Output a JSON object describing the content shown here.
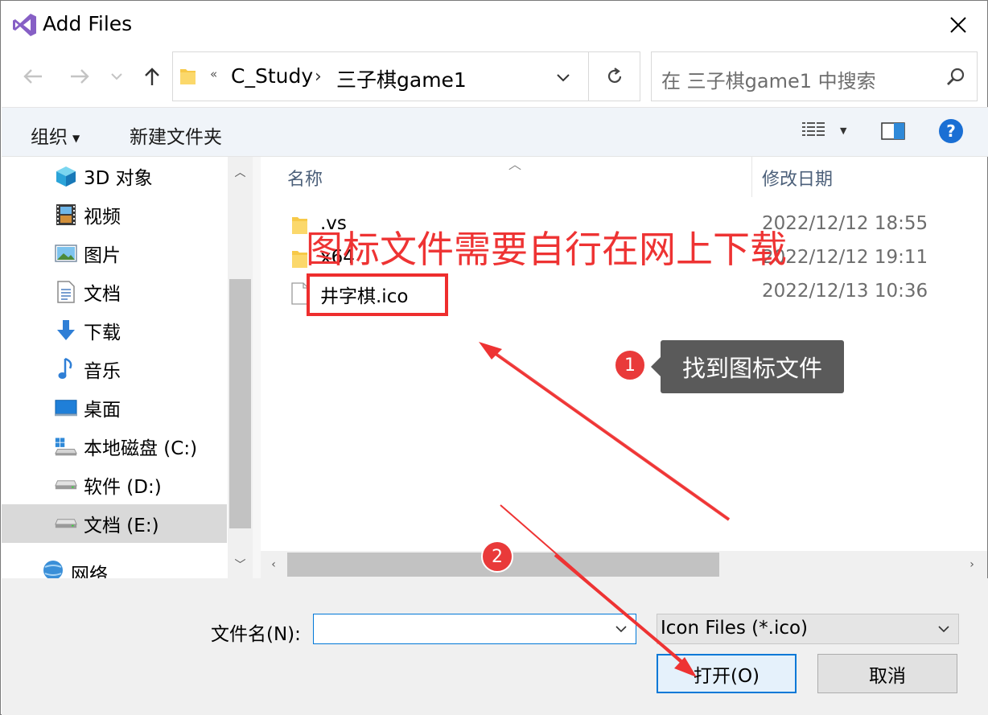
{
  "window": {
    "title": "Add Files",
    "close_icon": "close-icon"
  },
  "nav": {
    "back_icon": "arrow-left-icon",
    "forward_icon": "arrow-right-icon",
    "recent_icon": "chevron-down-icon",
    "up_icon": "arrow-up-icon"
  },
  "address": {
    "overflow": "«",
    "crumbs": [
      "C_Study",
      "三子棋game1"
    ],
    "separator": "›"
  },
  "search": {
    "placeholder": "在 三子棋game1 中搜索"
  },
  "commandbar": {
    "organize": "组织",
    "new_folder": "新建文件夹"
  },
  "sidebar": {
    "items": [
      {
        "label": "3D 对象",
        "icon": "cube-3d-icon"
      },
      {
        "label": "视频",
        "icon": "video-icon"
      },
      {
        "label": "图片",
        "icon": "picture-icon"
      },
      {
        "label": "文档",
        "icon": "document-icon"
      },
      {
        "label": "下载",
        "icon": "download-icon"
      },
      {
        "label": "音乐",
        "icon": "music-icon"
      },
      {
        "label": "桌面",
        "icon": "desktop-icon"
      },
      {
        "label": "本地磁盘 (C:)",
        "icon": "windows-drive-icon"
      },
      {
        "label": "软件 (D:)",
        "icon": "drive-icon"
      },
      {
        "label": "文档 (E:)",
        "icon": "drive-icon",
        "selected": true
      },
      {
        "label": "网络",
        "icon": "network-icon"
      }
    ]
  },
  "filelist": {
    "columns": {
      "name": "名称",
      "modified": "修改日期"
    },
    "files": [
      {
        "name": ".vs",
        "modified": "2022/12/12 18:55",
        "type": "folder"
      },
      {
        "name": "x64",
        "modified": "2022/12/12 19:11",
        "type": "folder"
      },
      {
        "name": "井字棋.ico",
        "modified": "2022/12/13 10:36",
        "type": "file"
      }
    ]
  },
  "footer": {
    "filename_label": "文件名(N):",
    "filename_value": "",
    "filetype_value": "Icon Files (*.ico)",
    "open_button": "打开(O)",
    "cancel_button": "取消"
  },
  "annotations": {
    "headline": "图标文件需要自行在网上下载",
    "step1_number": "1",
    "step1_text": "找到图标文件",
    "step2_number": "2",
    "color": "#ee3333"
  }
}
